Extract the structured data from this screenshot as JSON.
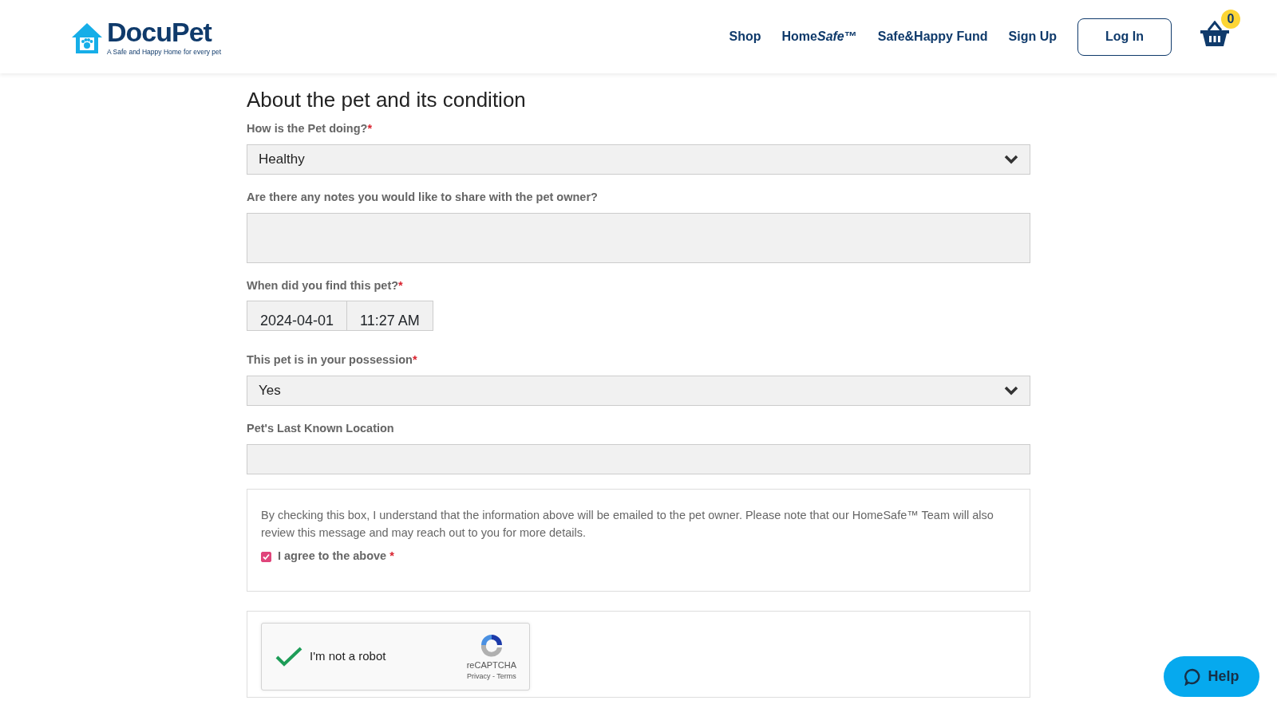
{
  "header": {
    "logo": {
      "name": "DocuPet",
      "tagline": "A Safe and Happy Home for every pet"
    },
    "nav": [
      {
        "label": "Shop"
      },
      {
        "label_parts": [
          {
            "text": "Home",
            "italic": false
          },
          {
            "text": "Safe",
            "italic": true
          },
          {
            "text": "™",
            "italic": false
          }
        ]
      },
      {
        "label": "Safe&Happy Fund"
      },
      {
        "label": "Sign Up"
      }
    ],
    "login_button": "Log In",
    "cart_count": "0"
  },
  "form": {
    "title": "About the pet and its condition",
    "fields": [
      {
        "kind": "select",
        "label": "How is the Pet doing?",
        "required_mark": "*",
        "value": "Healthy"
      },
      {
        "kind": "textarea",
        "label": "Are there any notes you would like to share with the pet owner?"
      },
      {
        "kind": "datetime",
        "label": "When did you find this pet?",
        "required_mark": "*",
        "date": "2024-04-01",
        "time": "11:27 AM"
      },
      {
        "kind": "select",
        "label": "This pet is in your possession",
        "required_mark": "*",
        "value": "Yes"
      },
      {
        "kind": "text",
        "label": "Pet's Last Known Location"
      }
    ],
    "consent": {
      "text": "By checking this box, I understand that the information above will be emailed to the pet owner. Please note that our HomeSafe™ Team will also review this message and may reach out to you for more details.",
      "checkbox_label": "I agree to the above",
      "required_mark": "*",
      "checked": true
    },
    "captcha": {
      "label": "I'm not a robot",
      "checked": true,
      "brand": "reCAPTCHA",
      "links": "Privacy - Terms"
    }
  },
  "help_button": "Help"
}
